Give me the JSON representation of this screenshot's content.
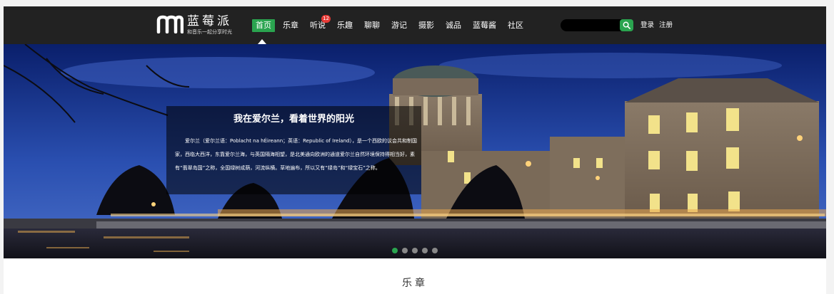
{
  "header": {
    "logo": {
      "title": "蓝莓派",
      "slogan": "和音乐一起分享时光"
    },
    "nav": [
      {
        "label": "首页",
        "active": true
      },
      {
        "label": "乐章"
      },
      {
        "label": "听说",
        "badge": "12"
      },
      {
        "label": "乐趣"
      },
      {
        "label": "聊聊"
      },
      {
        "label": "游记"
      },
      {
        "label": "摄影"
      },
      {
        "label": "诚品"
      },
      {
        "label": "蓝莓酱"
      },
      {
        "label": "社区"
      }
    ],
    "search": {
      "placeholder": "",
      "icon": "search-icon"
    },
    "auth": {
      "login": "登录",
      "register": "注册"
    }
  },
  "banner": {
    "caption_title": "我在爱尔兰，看着世界的阳光",
    "caption_body": "爱尔兰（爱尔兰语：Poblacht na hÉireann；英语：Republic of Ireland），是一个西欧的议会共和制国家，西临大西洋，东靠爱尔兰海，与英国隔海相望，是北美通向欧洲的通道爱尔兰自然环境保持得相当好，素有“翡翠岛国”之称，全国绿树成荫，河流纵横。草地遍布，所以又有“绿岛”和“绿宝石”之称。",
    "slides": 5,
    "active_slide": 1
  },
  "section": {
    "title": "乐章"
  },
  "colors": {
    "header_bg": "#222222",
    "accent": "#2aa44f",
    "badge": "#e53935"
  }
}
